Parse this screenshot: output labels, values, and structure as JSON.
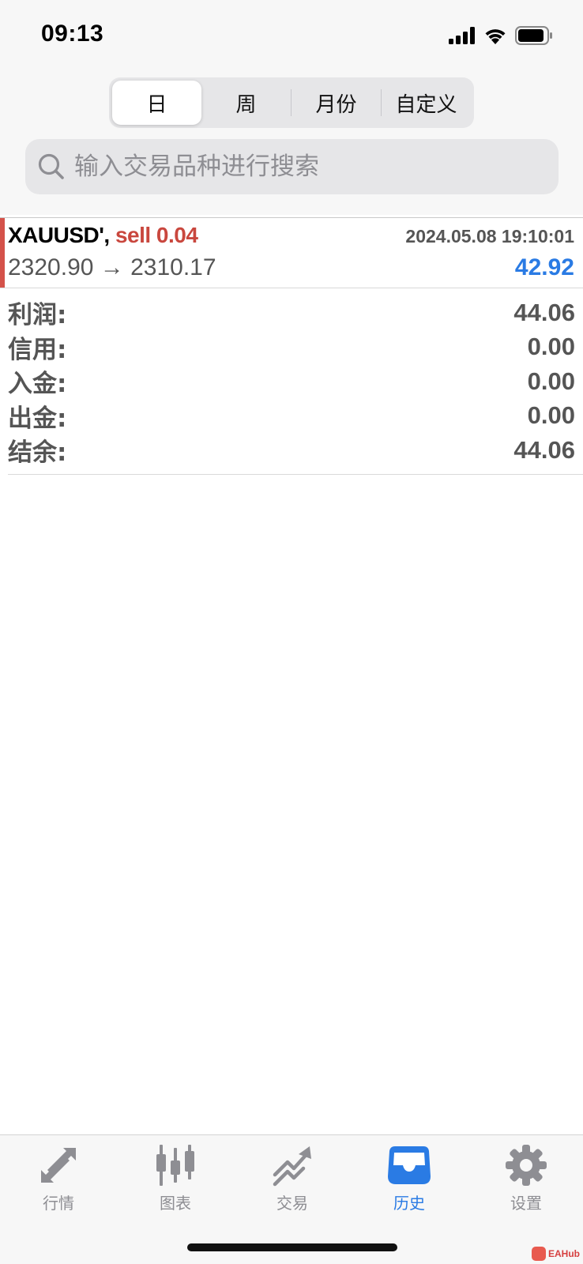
{
  "status_bar": {
    "time": "09:13"
  },
  "segmented": {
    "tabs": [
      {
        "label": "日",
        "active": true
      },
      {
        "label": "周",
        "active": false
      },
      {
        "label": "月份",
        "active": false
      },
      {
        "label": "自定义",
        "active": false
      }
    ]
  },
  "search": {
    "placeholder": "输入交易品种进行搜索",
    "value": ""
  },
  "deal": {
    "symbol": "XAUUSD',",
    "side": "sell 0.04",
    "time": "2024.05.08 19:10:01",
    "prices": "2320.90 → 2310.17",
    "profit": "42.92"
  },
  "summary": [
    {
      "label": "利润:",
      "value": "44.06"
    },
    {
      "label": "信用:",
      "value": "0.00"
    },
    {
      "label": "入金:",
      "value": "0.00"
    },
    {
      "label": "出金:",
      "value": "0.00"
    },
    {
      "label": "结余:",
      "value": "44.06"
    }
  ],
  "tabbar": {
    "items": [
      {
        "label": "行情",
        "icon": "quotes-icon",
        "active": false
      },
      {
        "label": "图表",
        "icon": "chart-icon",
        "active": false
      },
      {
        "label": "交易",
        "icon": "trade-icon",
        "active": false
      },
      {
        "label": "历史",
        "icon": "history-icon",
        "active": true
      },
      {
        "label": "设置",
        "icon": "settings-icon",
        "active": false
      }
    ]
  },
  "watermark": {
    "text": "EAHub"
  },
  "colors": {
    "accent_blue": "#2a7be4",
    "sell_red": "#c9473e",
    "inactive_gray": "#8e8e93"
  }
}
